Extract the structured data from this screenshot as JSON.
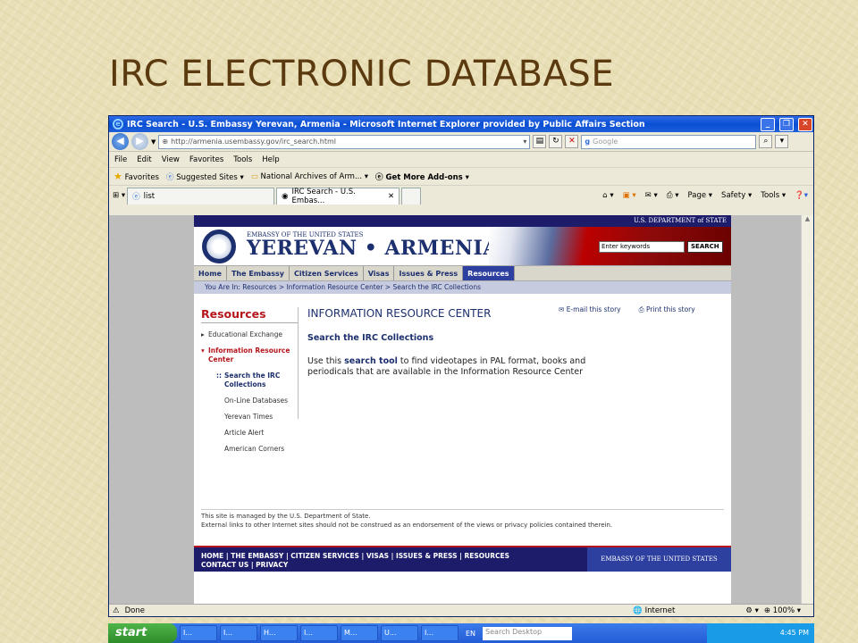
{
  "slide": {
    "title": "IRC ELECTRONIC DATABASE"
  },
  "browser": {
    "window_title": "IRC Search - U.S. Embassy Yerevan, Armenia - Microsoft Internet Explorer provided by Public Affairs Section",
    "address": "http://armenia.usembassy.gov/irc_search.html",
    "search_placeholder": "Google",
    "menu": [
      "File",
      "Edit",
      "View",
      "Favorites",
      "Tools",
      "Help"
    ],
    "favorites": {
      "label": "Favorites",
      "items": [
        "Suggested Sites ▾",
        "National Archives of Arm... ▾",
        "Get More Add-ons ▾"
      ]
    },
    "tabs": [
      "list",
      "IRC Search - U.S. Embas..."
    ],
    "commands": [
      "Page ▾",
      "Safety ▾",
      "Tools ▾"
    ],
    "status": "Done",
    "zone": "Internet",
    "zoom": "100%"
  },
  "site": {
    "dos": "U.S. DEPARTMENT of STATE",
    "banner_small": "EMBASSY OF THE UNITED STATES",
    "banner_title": "YEREVAN • ARMENIA",
    "search_placeholder": "Enter keywords",
    "search_button": "SEARCH",
    "nav": [
      "Home",
      "The Embassy",
      "Citizen Services",
      "Visas",
      "Issues & Press",
      "Resources"
    ],
    "breadcrumb": "You Are In: Resources > Information Resource Center > Search the IRC Collections",
    "side_heading": "Resources",
    "side_items": {
      "educational": "Educational Exchange",
      "irc": "Information Resource Center",
      "search": "Search the IRC Collections",
      "online": "On-Line Databases",
      "times": "Yerevan Times",
      "alert": "Article Alert",
      "corners": "American Corners"
    },
    "email": "E-mail this story",
    "print": "Print this story",
    "heading": "INFORMATION RESOURCE CENTER",
    "subheading": "Search the IRC Collections",
    "body_pre": "Use this",
    "body_link": "search tool",
    "body_post": "to find videotapes in PAL format, books and periodicals that are available in the Information Resource Center",
    "footer_line1": "This site is managed by the U.S. Department of State.",
    "footer_line2": "External links to other Internet sites should not be construed as an endorsement of the views or privacy policies contained therein.",
    "footer_links1": "HOME | THE EMBASSY | CITIZEN SERVICES | VISAS | ISSUES & PRESS | RESOURCES",
    "footer_links2": "CONTACT US | PRIVACY",
    "footer_embassy": "EMBASSY OF THE UNITED STATES"
  },
  "taskbar": {
    "start": "start",
    "items": [
      "I...",
      "I...",
      "H...",
      "I...",
      "M...",
      "U...",
      "I..."
    ],
    "lang": "EN",
    "search": "Search Desktop",
    "time": "4:45 PM"
  }
}
